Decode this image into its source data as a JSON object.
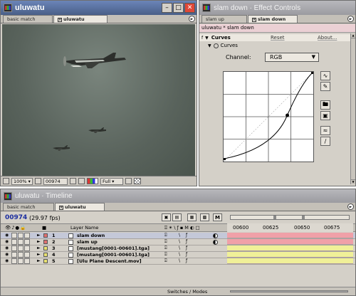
{
  "comp_window": {
    "title": "uluwatu",
    "tabs": [
      "basic match",
      "uluwatu"
    ],
    "active_tab": 1,
    "status": {
      "zoom": "100%",
      "timecode": "00974",
      "resolution": "Full"
    }
  },
  "effects_window": {
    "title": "slam down · Effect Controls",
    "tabs": [
      "slam up",
      "slam down"
    ],
    "active_tab": 1,
    "breadcrumb": "uluwatu * slam down",
    "effect_name": "Curves",
    "reset_label": "Reset",
    "about_label": "About...",
    "property_label": "Curves",
    "channel_label": "Channel:",
    "channel_value": "RGB"
  },
  "timeline_window": {
    "title": "uluwatu · Timeline",
    "tabs": [
      "basic match",
      "uluwatu"
    ],
    "active_tab": 1,
    "timecode": "00974",
    "fps": "(29.97 fps)",
    "column_layer_name": "Layer Name",
    "ruler_labels": [
      "00600",
      "00625",
      "00650",
      "00675"
    ],
    "layers": [
      {
        "num": "1",
        "name": "slam down",
        "color": "#e07070",
        "selected": true
      },
      {
        "num": "2",
        "name": "slam up",
        "color": "#e07070",
        "selected": false
      },
      {
        "num": "3",
        "name": "[mustang[0001-00601].tga]",
        "color": "#e8e070",
        "selected": false
      },
      {
        "num": "4",
        "name": "[mustang[0001-00601].tga]",
        "color": "#e8e070",
        "selected": false
      },
      {
        "num": "5",
        "name": "[Ulu Plane Descent.mov]",
        "color": "#e8e070",
        "selected": false
      }
    ],
    "footer_label": "Switches / Modes"
  },
  "colors": {
    "accent_title": "#4a5f88",
    "close_button": "#e04838",
    "layer_pink": "#f0a0a8",
    "layer_yellow": "#f0f098",
    "timecode_blue": "#1c2ea0"
  }
}
